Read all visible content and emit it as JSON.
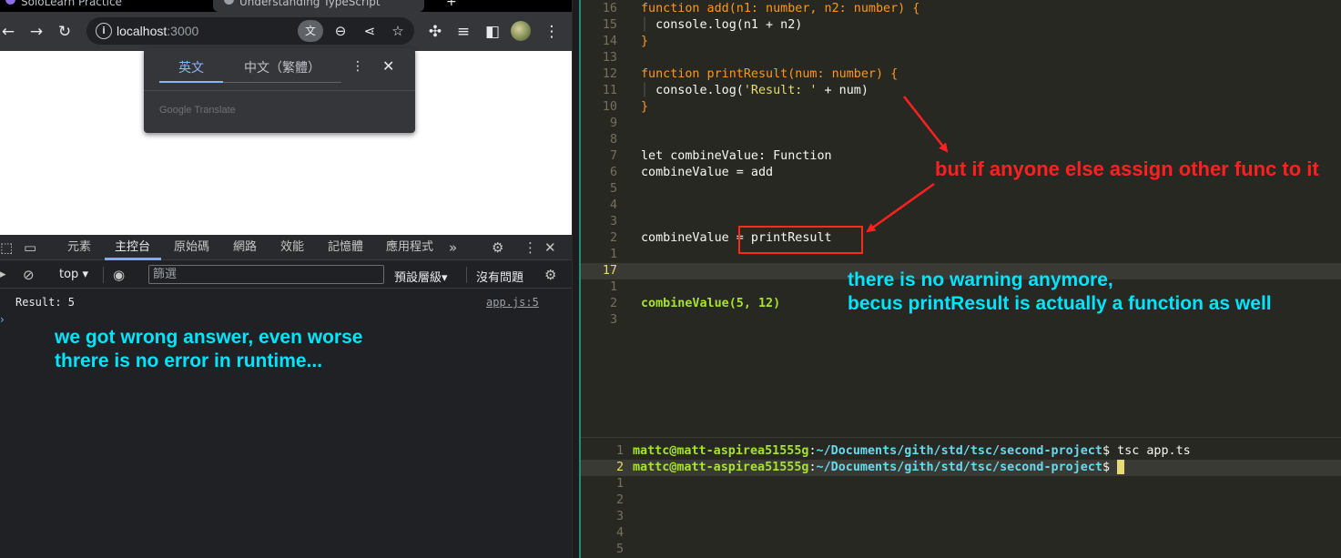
{
  "browser": {
    "tabs": [
      {
        "title": "SoloLearn Practice"
      },
      {
        "title": "Understanding TypeScript"
      }
    ],
    "new_tab": "+",
    "url_host": "localhost",
    "url_port": ":3000",
    "translate_popup": {
      "tab_source": "英文",
      "tab_target": "中文（繁體）",
      "brand": "Google Translate"
    }
  },
  "devtools": {
    "tabs": [
      "元素",
      "主控台",
      "原始碼",
      "網路",
      "效能",
      "記憶體",
      "應用程式"
    ],
    "active_tab": "主控台",
    "context": "top",
    "filter_placeholder": "篩選",
    "levels": "預設層級",
    "issues": "沒有問題",
    "log_text": "Result: 5",
    "log_source": "app.js:5",
    "annotation_line1": "we got wrong answer, even worse",
    "annotation_line2": "threre is no error in runtime..."
  },
  "editor": {
    "line_numbers": [
      "16",
      "15",
      "14",
      "13",
      "12",
      "11",
      "10",
      "9",
      "8",
      "7",
      "6",
      "5",
      "4",
      "3",
      "2",
      "1",
      "17",
      "1",
      "2",
      "3"
    ],
    "code": {
      "l_add_sig": "function add(n1: number, n2: number) {",
      "l_add_body": "console.log(n1 + n2)",
      "l_print_sig": "function printResult(num: number) {",
      "l_print_body_str": "'Result: '",
      "l_let": "let combineValue: Function",
      "l_assign_add": "combineValue = add",
      "l_assign_print": "combineValue = printResult",
      "l_call": "combineValue(5, 12)"
    },
    "annotation_red": "but if anyone else assign other func to it",
    "annotation_cyan_line1": "there is no warning anymore,",
    "annotation_cyan_line2": "becus printResult is actually a function as well"
  },
  "terminal": {
    "line_numbers": [
      "1",
      "2",
      "1",
      "2",
      "3",
      "4",
      "5"
    ],
    "user_host": "mattc@matt-aspirea51555g",
    "path": "~/Documents/gith/std/tsc/second-project",
    "command1": "tsc app.ts"
  },
  "colors": {
    "annotation_red": "#ff2020",
    "annotation_cyan": "#00e5ff",
    "editor_bg": "#272822"
  }
}
